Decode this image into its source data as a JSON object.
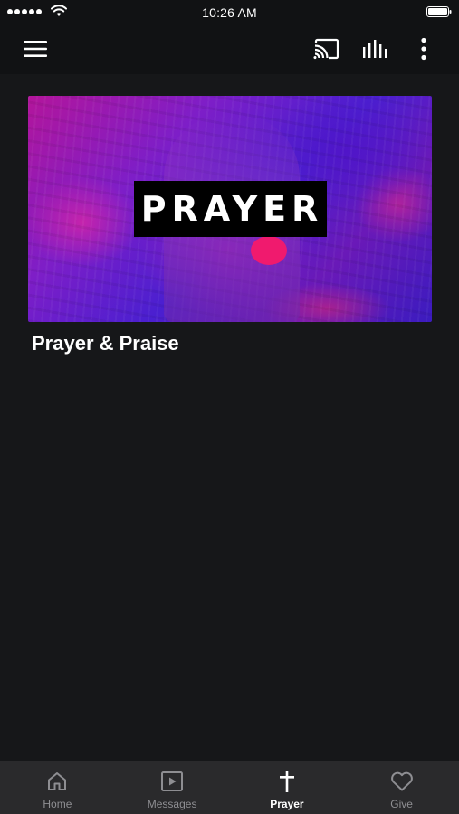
{
  "status_bar": {
    "time": "10:26 AM",
    "signal_icon": "signal-dots-icon",
    "wifi_icon": "wifi-icon",
    "battery_icon": "battery-icon"
  },
  "app_bar": {
    "menu_icon": "hamburger-menu-icon",
    "cast_icon": "cast-icon",
    "audio_icon": "equalizer-icon",
    "more_icon": "more-vertical-icon"
  },
  "content": {
    "card": {
      "image_text": "PRAYER",
      "title": "Prayer & Praise"
    }
  },
  "tab_bar": {
    "tabs": [
      {
        "label": "Home",
        "icon": "home-icon",
        "active": false
      },
      {
        "label": "Messages",
        "icon": "play-square-icon",
        "active": false
      },
      {
        "label": "Prayer",
        "icon": "cross-icon",
        "active": true
      },
      {
        "label": "Give",
        "icon": "heart-icon",
        "active": false
      }
    ]
  },
  "colors": {
    "background": "#161719",
    "bar": "#111214",
    "tab_bar": "#2a2a2c",
    "tab_inactive": "#8e8e92",
    "tab_active": "#ffffff"
  }
}
